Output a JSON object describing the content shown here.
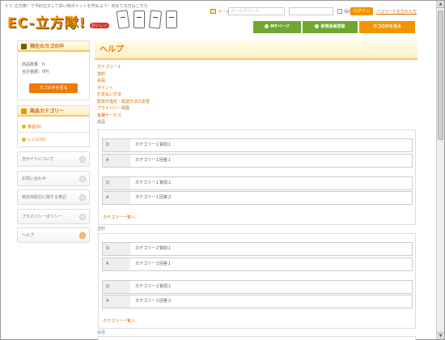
{
  "header": {
    "tagline": "ＥＣ-立方隊！で予約注文して買い物ポイントを貯めよう！初めての方はこちら",
    "logo_text": "EC-立方隊!",
    "logo_badge": "おいしい",
    "mail_label": "メール",
    "mail_placeholder": "メールアドレス",
    "save_label": "保存",
    "login_button": "ログイン",
    "forgot_link": "パスワードを忘れた方"
  },
  "nav": {
    "mypage": "MYページ",
    "signup": "新規会員登録",
    "cart": "カゴの中を見る"
  },
  "sidebar": {
    "cart_title": "現在のカゴの中",
    "cart_count": "商品数量：0",
    "cart_total": "合計金額：0円",
    "cart_button": "カゴの中を見る",
    "category_title": "商品カテゴリー",
    "categories": [
      "食品(0)",
      "レシピ(0)"
    ],
    "links": [
      "当サイトについて",
      "お問い合わせ",
      "特定商取引に関する表記",
      "プライバシーポリシー",
      "ヘルプ"
    ]
  },
  "main": {
    "title": "ヘルプ",
    "toc": [
      "カテゴリー１",
      "送料",
      "会員",
      "ポイント",
      "お支払い方法",
      "配達日指定・配送方法の変更",
      "プライバシー保護",
      "各種サービス"
    ],
    "toc_extra": "返品",
    "section1": {
      "label": "",
      "rows": [
        {
          "tag": "Q",
          "text": "カテゴリー１質問１"
        },
        {
          "tag": "A",
          "text": "カテゴリー１回答１"
        },
        {
          "tag": "Q",
          "text": "カテゴリー１質問２"
        },
        {
          "tag": "A",
          "text": "カテゴリー１回答２"
        }
      ],
      "back": "カテゴリー一覧へ"
    },
    "section2": {
      "label": "送料",
      "rows": [
        {
          "tag": "Q",
          "text": "カテゴリー２質問１"
        },
        {
          "tag": "A",
          "text": "カテゴリー２回答１"
        },
        {
          "tag": "Q",
          "text": "カテゴリー２質問２"
        },
        {
          "tag": "A",
          "text": "カテゴリー２回答２"
        }
      ],
      "back": "カテゴリー一覧へ"
    },
    "section3_label": "会員"
  }
}
